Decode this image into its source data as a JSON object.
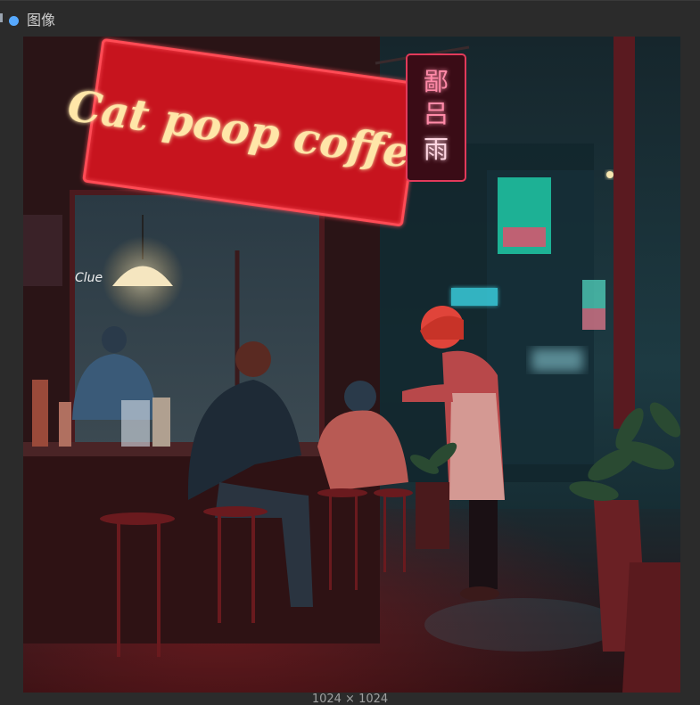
{
  "node": {
    "title": "图像",
    "status_color": "#57a9ff"
  },
  "image": {
    "sign_text": "Cat poop coffee",
    "hanging_sign_glyphs": [
      "鄙",
      "吕",
      "雨"
    ],
    "small_window_sign": "Clue",
    "dimensions_label": "1024 × 1024"
  }
}
